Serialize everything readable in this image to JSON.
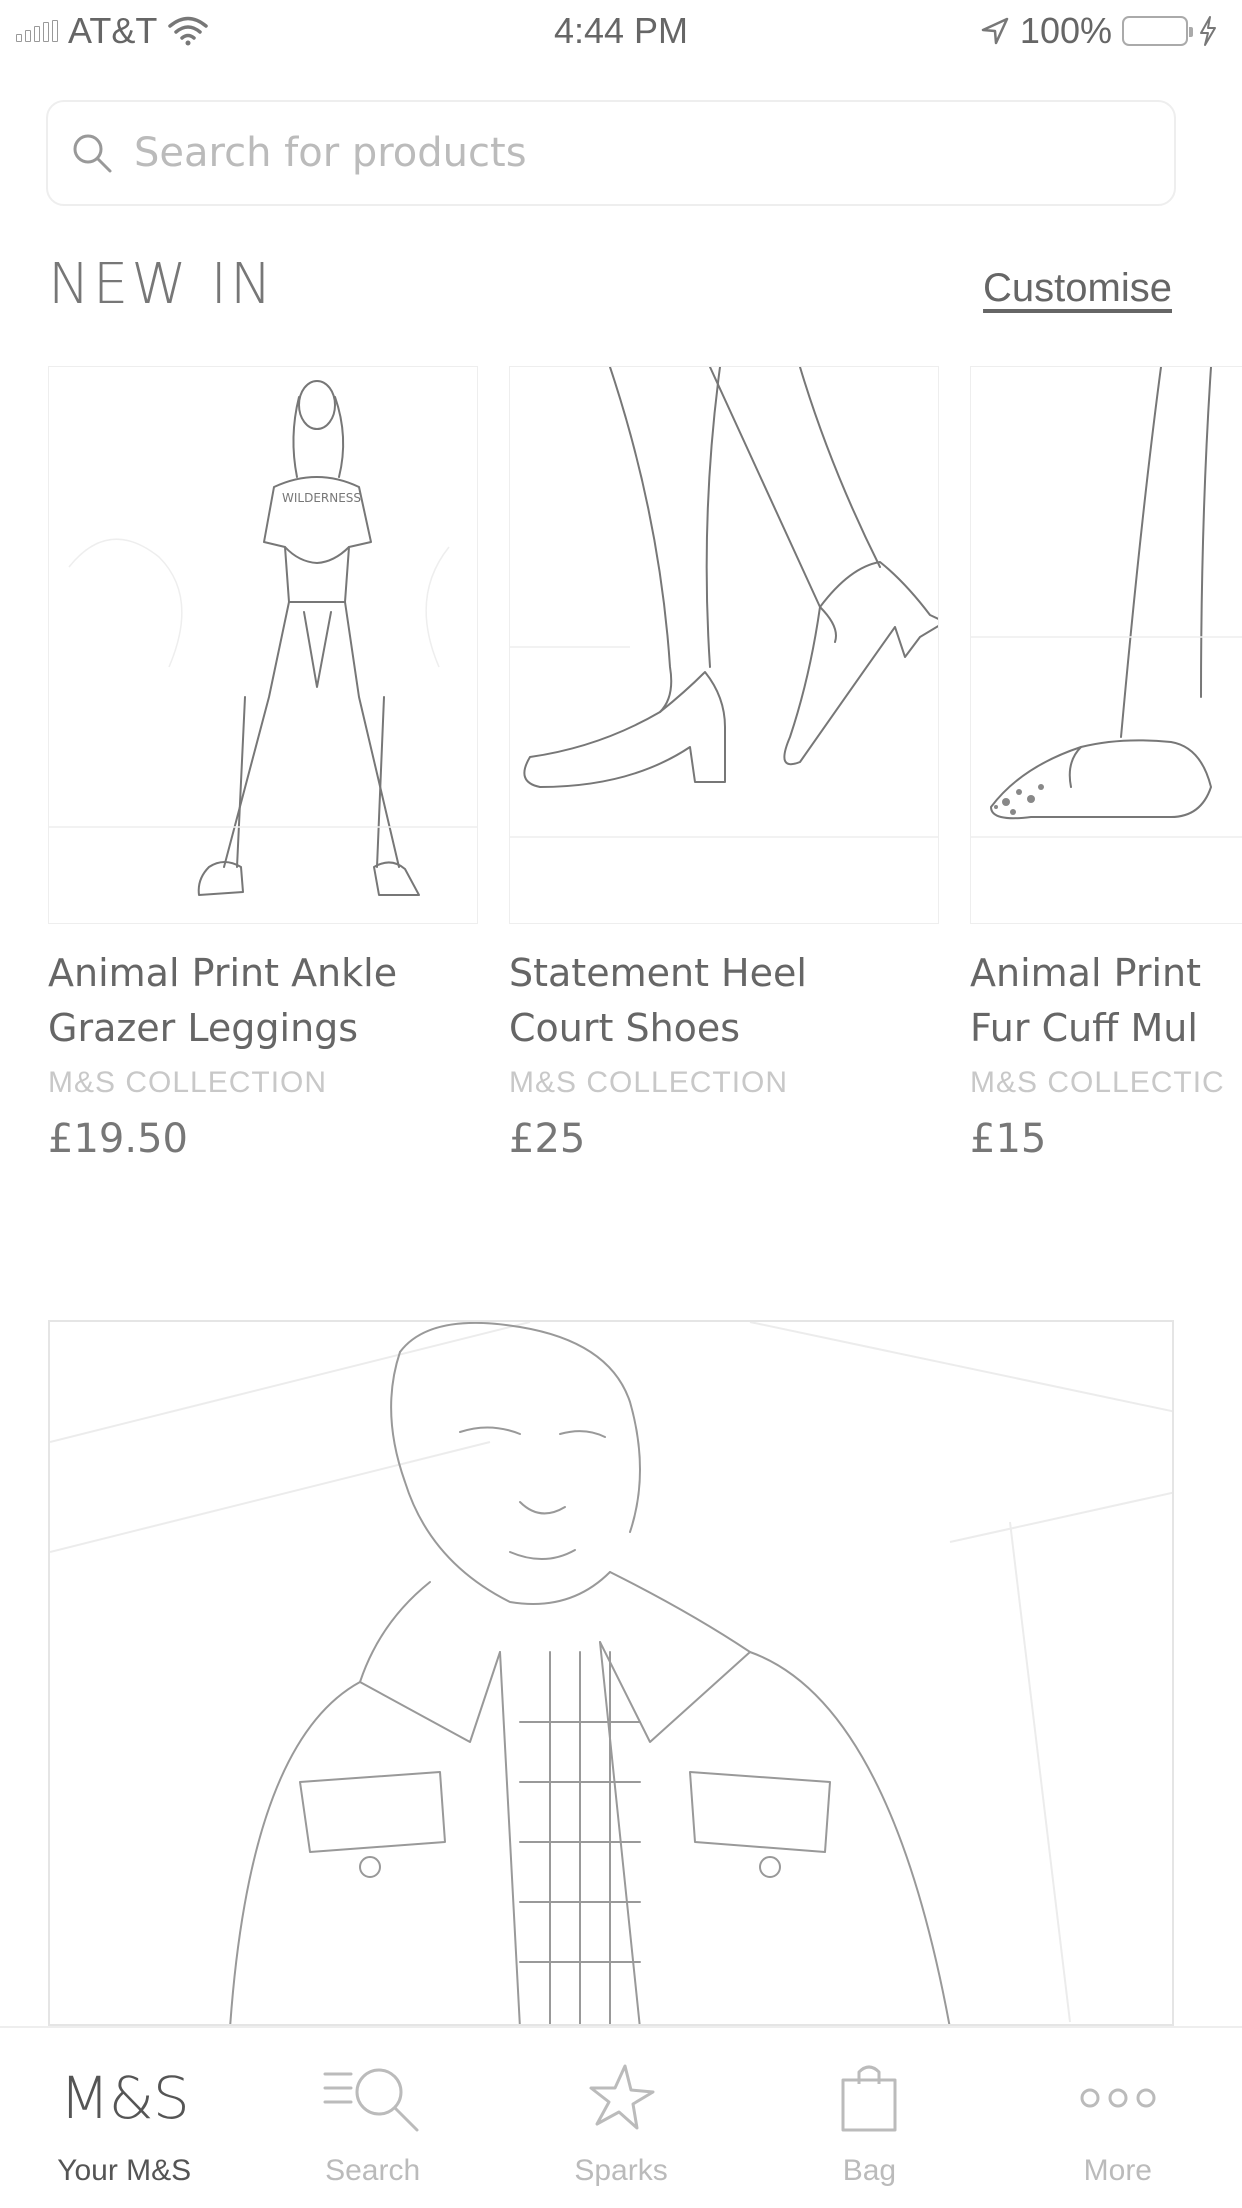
{
  "status_bar": {
    "carrier": "AT&T",
    "time": "4:44 PM",
    "battery": "100%"
  },
  "search": {
    "placeholder": "Search for products"
  },
  "section": {
    "title": "NEW IN",
    "action_label": "Customise"
  },
  "products": [
    {
      "name_line1": "Animal Print Ankle",
      "name_line2": "Grazer Leggings",
      "brand": "M&S COLLECTION",
      "price": "£19.50"
    },
    {
      "name_line1": "Statement Heel",
      "name_line2": "Court Shoes",
      "brand": "M&S COLLECTION",
      "price": "£25"
    },
    {
      "name_line1": "Animal Print",
      "name_line2": "Fur Cuff Mul",
      "brand": "M&S COLLECTIC",
      "price": "£15"
    }
  ],
  "tab_bar": {
    "tabs": [
      {
        "label": "Your M&S",
        "icon": "ms-logo-icon",
        "logo_text": "M&S"
      },
      {
        "label": "Search",
        "icon": "search-list-icon"
      },
      {
        "label": "Sparks",
        "icon": "star-icon"
      },
      {
        "label": "Bag",
        "icon": "bag-icon"
      },
      {
        "label": "More",
        "icon": "more-dots-icon"
      }
    ]
  }
}
